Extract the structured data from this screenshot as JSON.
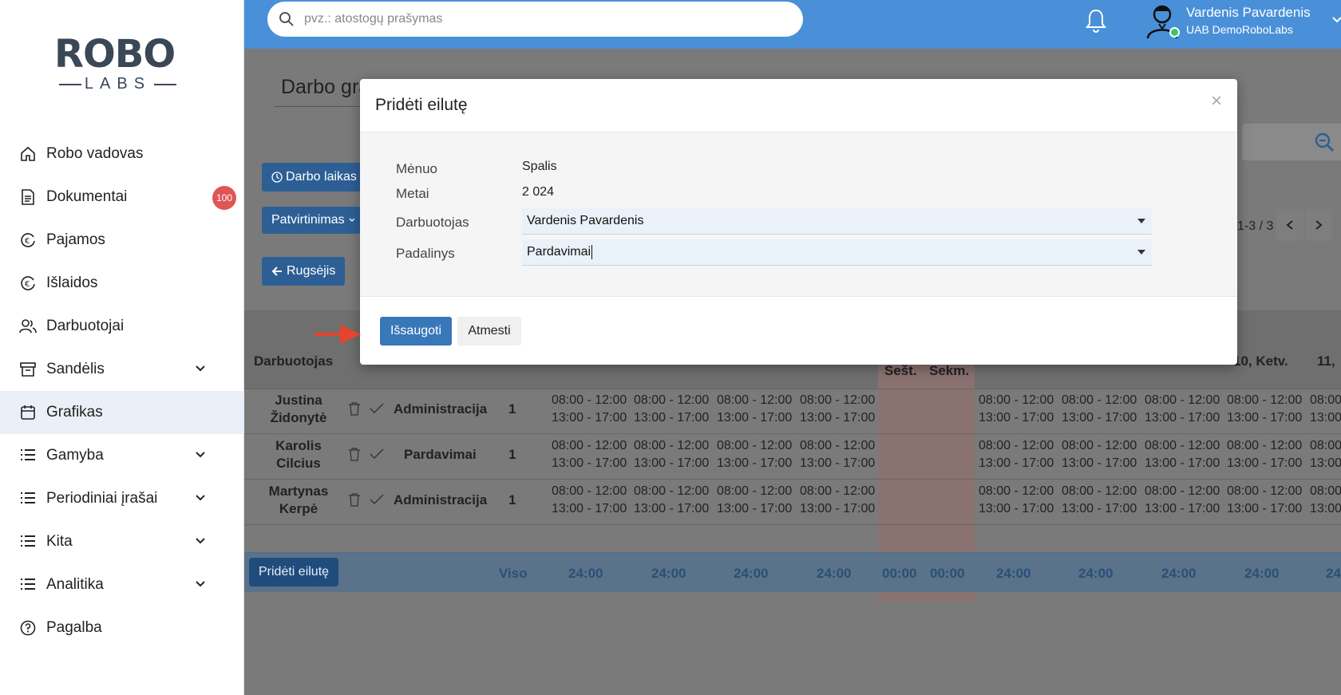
{
  "sidebar": {
    "logo_top": "ROBO",
    "logo_bottom": "LABS",
    "items": [
      {
        "label": "Robo vadovas",
        "icon": "home-icon"
      },
      {
        "label": "Dokumentai",
        "icon": "document-icon",
        "badge": "100"
      },
      {
        "label": "Pajamos",
        "icon": "euro-in-icon"
      },
      {
        "label": "Išlaidos",
        "icon": "euro-out-icon"
      },
      {
        "label": "Darbuotojai",
        "icon": "users-icon"
      },
      {
        "label": "Sandėlis",
        "icon": "archive-icon"
      },
      {
        "label": "Grafikas",
        "icon": "calendar-icon"
      },
      {
        "label": "Gamyba",
        "icon": "list-icon"
      },
      {
        "label": "Periodiniai įrašai",
        "icon": "list-icon"
      },
      {
        "label": "Kita",
        "icon": "list-icon"
      },
      {
        "label": "Analitika",
        "icon": "list-icon"
      },
      {
        "label": "Pagalba",
        "icon": "help-icon"
      }
    ],
    "active": "Grafikas"
  },
  "topbar": {
    "search_placeholder": "pvz.: atostogų prašymas",
    "user_name": "Vardenis Pavardenis",
    "company": "UAB DemoRoboLabs"
  },
  "page": {
    "title": "Darbo gra",
    "buttons": {
      "work_time": "Darbo laikas",
      "approval": "Patvirtinimas",
      "prev_month": "Rugsėjis"
    },
    "pager": "1-3 / 3",
    "columns": {
      "employee": "Darbuotojas",
      "sat": "Šešt.",
      "sun": "Sekm.",
      "day10": "10, Ketv.",
      "day11": "11,"
    },
    "rows": [
      {
        "first": "Justina",
        "last": "Židonytė",
        "dept": "Administracija",
        "num": "1"
      },
      {
        "first": "Karolis",
        "last": "Cilcius",
        "dept": "Pardavimai",
        "num": "1"
      },
      {
        "first": "Martynas",
        "last": "Kerpė",
        "dept": "Administracija",
        "num": "1"
      }
    ],
    "shift_morning": "08:00 - 12:00",
    "shift_afternoon": "13:00 - 17:00",
    "shift_partial": "08:00",
    "shift_partial2": "13:00",
    "add_row": "Pridėti eilutę",
    "total_label": "Viso",
    "totals": [
      "24:00",
      "24:00",
      "24:00",
      "24:00",
      "00:00",
      "00:00",
      "24:00",
      "24:00",
      "24:00",
      "24:00",
      "24"
    ]
  },
  "modal": {
    "title": "Pridėti eilutę",
    "close": "×",
    "fields": {
      "month_label": "Mėnuo",
      "month_value": "Spalis",
      "year_label": "Metai",
      "year_value": "2 024",
      "employee_label": "Darbuotojas",
      "employee_value": "Vardenis Pavardenis",
      "unit_label": "Padalinys",
      "unit_value": "Pardavimai"
    },
    "save": "Išsaugoti",
    "cancel": "Atmesti"
  },
  "colors": {
    "topbar": "#4a90d9",
    "primary": "#3877b8",
    "badge": "#e05555",
    "arrow": "#e8432e"
  }
}
